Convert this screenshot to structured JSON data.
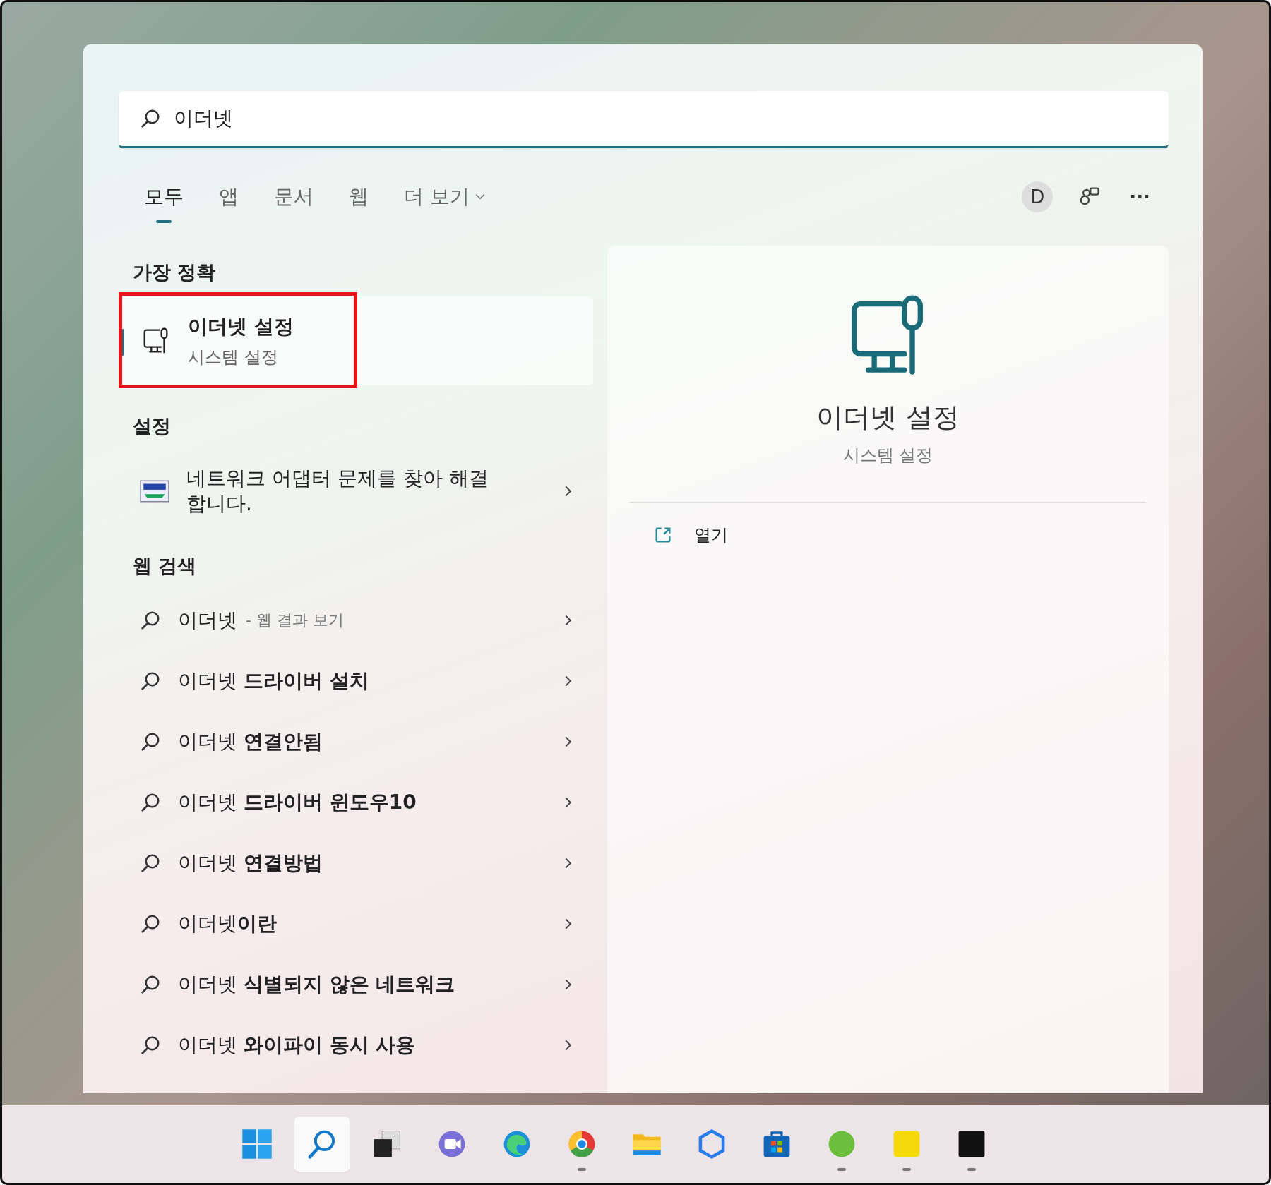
{
  "search": {
    "value": "이더넷"
  },
  "tabs": [
    {
      "label": "모두",
      "selected": true
    },
    {
      "label": "앱",
      "selected": false
    },
    {
      "label": "문서",
      "selected": false
    },
    {
      "label": "웹",
      "selected": false
    },
    {
      "label": "더 보기",
      "selected": false
    }
  ],
  "account": {
    "initial": "D"
  },
  "more_button": "···",
  "best_match": {
    "heading": "가장 정확",
    "title": "이더넷 설정",
    "subtitle": "시스템 설정",
    "selected": true,
    "highlighted": true
  },
  "settings": {
    "heading": "설정",
    "items": [
      {
        "label": "네트워크 어댑터 문제를 찾아 해결합니다."
      }
    ]
  },
  "web_search": {
    "heading": "웹 검색",
    "items": [
      {
        "label": "이더넷",
        "hint": "- 웹 결과 보기"
      },
      {
        "label": "이더넷 **드라이버 설치**"
      },
      {
        "label": "이더넷 **연결안됨**"
      },
      {
        "label": "이더넷 **드라이버 윈도우10**"
      },
      {
        "label": "이더넷 **연결방법**"
      },
      {
        "label": "이더넷**이란**"
      },
      {
        "label": "이더넷 **식별되지 않은 네트워크**"
      },
      {
        "label": "이더넷 **와이파이 동시 사용**"
      }
    ]
  },
  "preview": {
    "title": "이더넷 설정",
    "subtitle": "시스템 설정",
    "actions": [
      {
        "label": "열기"
      }
    ]
  },
  "taskbar": [
    {
      "kind": "start",
      "selected": false,
      "running": false
    },
    {
      "kind": "search",
      "selected": true,
      "running": false
    },
    {
      "kind": "taskview",
      "selected": false,
      "running": false
    },
    {
      "kind": "chat",
      "selected": false,
      "running": false
    },
    {
      "kind": "edge",
      "selected": false,
      "running": false
    },
    {
      "kind": "chrome",
      "selected": false,
      "running": true
    },
    {
      "kind": "folder",
      "selected": false,
      "running": false
    },
    {
      "kind": "cortana",
      "selected": false,
      "running": false
    },
    {
      "kind": "store",
      "selected": false,
      "running": false
    },
    {
      "kind": "green",
      "selected": false,
      "running": true
    },
    {
      "kind": "yellow",
      "selected": false,
      "running": true
    },
    {
      "kind": "black",
      "selected": false,
      "running": true
    }
  ]
}
